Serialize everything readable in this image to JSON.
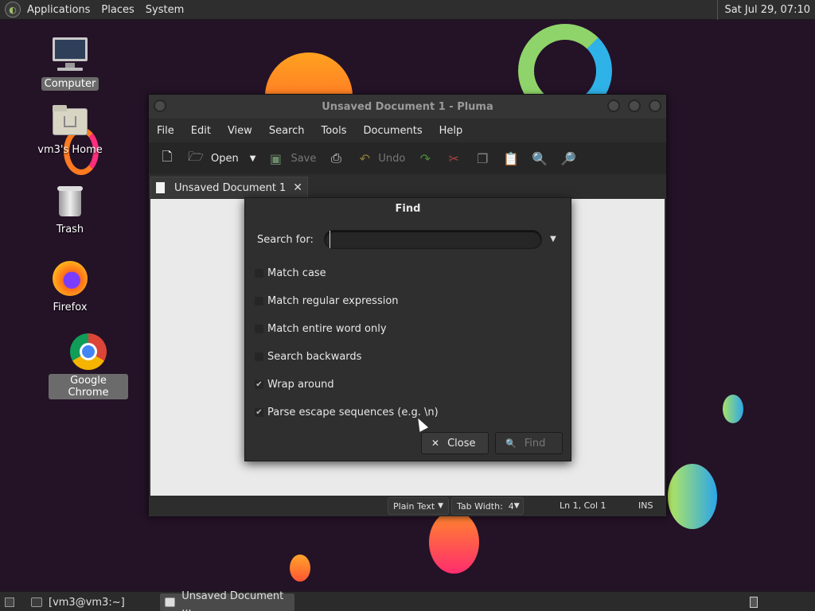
{
  "top_panel": {
    "menus": [
      "Applications",
      "Places",
      "System"
    ],
    "clock": "Sat Jul 29, 07:10"
  },
  "desktop": {
    "icons": {
      "computer": "Computer",
      "home": "vm3's Home",
      "trash": "Trash",
      "firefox": "Firefox",
      "chrome": "Google Chrome"
    }
  },
  "pluma": {
    "title": "Unsaved Document 1 - Pluma",
    "menus": [
      "File",
      "Edit",
      "View",
      "Search",
      "Tools",
      "Documents",
      "Help"
    ],
    "toolbar": {
      "open": "Open",
      "save": "Save",
      "undo": "Undo"
    },
    "tab_label": "Unsaved Document 1",
    "status": {
      "language": "Plain Text",
      "tab_width": "Tab Width:  4",
      "position": "Ln 1, Col 1",
      "mode": "INS"
    }
  },
  "find_dialog": {
    "title": "Find",
    "search_label": "Search for:",
    "search_value": "",
    "options": [
      {
        "label": "Match case",
        "checked": false
      },
      {
        "label": "Match regular expression",
        "checked": false
      },
      {
        "label": "Match entire word only",
        "checked": false
      },
      {
        "label": "Search backwards",
        "checked": false
      },
      {
        "label": "Wrap around",
        "checked": true
      },
      {
        "label": "Parse escape sequences (e.g. \\n)",
        "checked": true
      }
    ],
    "close_label": "Close",
    "find_label": "Find"
  },
  "bottom_panel": {
    "tasks": [
      "[vm3@vm3:~]",
      "Unsaved Document ..."
    ]
  }
}
